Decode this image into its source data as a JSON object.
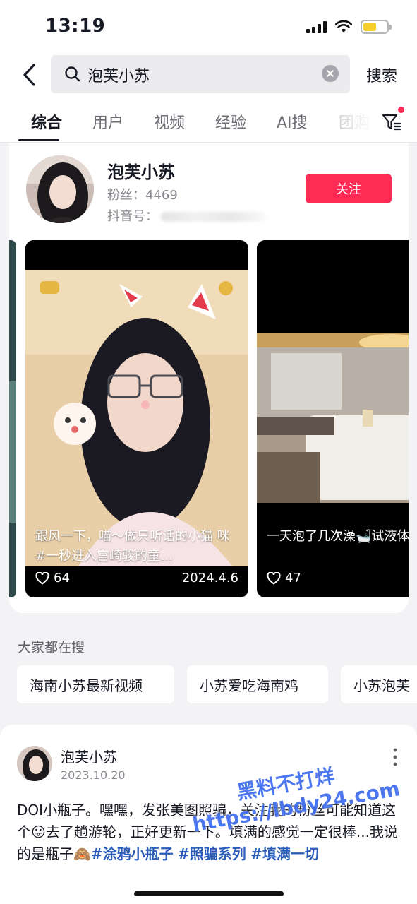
{
  "status_bar": {
    "time": "13:19"
  },
  "search": {
    "query": "泡芙小苏",
    "submit_label": "搜索"
  },
  "tabs": [
    {
      "label": "综合"
    },
    {
      "label": "用户"
    },
    {
      "label": "视频"
    },
    {
      "label": "经验"
    },
    {
      "label": "AI搜"
    },
    {
      "label": "团购"
    }
  ],
  "user": {
    "name": "泡芙小苏",
    "fans": "粉丝：4469",
    "id_label": "抖音号：",
    "follow_label": "关注"
  },
  "videos": [
    {
      "caption": "跟风一下，喵～做只听话的小猫 咪 #一秒进入宫崎骏的童…",
      "likes": "64",
      "date": "2024.4.6"
    },
    {
      "caption": "一天泡了几次澡🛁试液体🙈别问，问就是",
      "likes": "47",
      "date": ""
    }
  ],
  "trending": {
    "title": "大家都在搜",
    "chips": [
      {
        "label": "海南小苏最新视频"
      },
      {
        "label": "小苏爱吃海南鸡"
      },
      {
        "label": "小苏泡芙"
      }
    ]
  },
  "post": {
    "author": "泡芙小苏",
    "date": "2023.10.20",
    "text": "DOI小瓶子。嘿嘿，发张美图照骗，关注我的粉丝可能知道这个😛去了趟游轮，正好更新一下。填满的感觉一定很棒...我说的是瓶子🙈",
    "hashtags": [
      "#涂鸦小瓶子",
      "#照骗系列",
      "#填满一切"
    ]
  },
  "watermark": {
    "line1": "黑料不打烊",
    "line2": "https://lbdy24.com"
  },
  "colors": {
    "accent": "#fe2c55",
    "hashtag": "#2b5db8",
    "battery": "#f7cf2b"
  }
}
